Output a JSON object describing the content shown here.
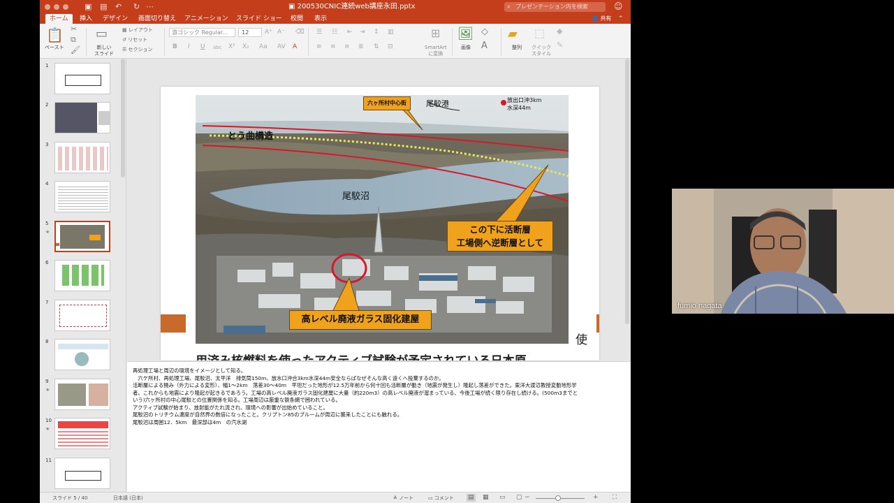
{
  "window": {
    "title": "200530CNIC連続web講座永田.pptx",
    "search_placeholder": "プレゼンテーション内を検索",
    "quick_access": [
      "save-icon",
      "undo-icon",
      "redo-icon"
    ]
  },
  "tabs": [
    {
      "label": "ホーム",
      "active": true
    },
    {
      "label": "挿入",
      "active": false
    },
    {
      "label": "デザイン",
      "active": false
    },
    {
      "label": "画面切り替え",
      "active": false
    },
    {
      "label": "アニメーション",
      "active": false
    },
    {
      "label": "スライド ショー",
      "active": false
    },
    {
      "label": "校閲",
      "active": false
    },
    {
      "label": "表示",
      "active": false
    }
  ],
  "share_label": "共有",
  "ribbon": {
    "paste": "ペースト",
    "new_slide": "新しい\nスライド",
    "layout": "レイアウト",
    "reset": "リセット",
    "section": "セクション",
    "font_name": "游ゴシック Regular...",
    "font_size": "12",
    "smartart": "SmartArt\nに変換",
    "picture": "画像",
    "arrange": "整列",
    "quick_styles": "クイック\nスタイル"
  },
  "thumbnails": [
    {
      "num": "1",
      "star": false,
      "kind": "title1"
    },
    {
      "num": "2",
      "star": false,
      "kind": "photo"
    },
    {
      "num": "3",
      "star": false,
      "kind": "doc"
    },
    {
      "num": "4",
      "star": false,
      "kind": "doc2"
    },
    {
      "num": "5",
      "star": true,
      "kind": "current"
    },
    {
      "num": "6",
      "star": false,
      "kind": "green"
    },
    {
      "num": "7",
      "star": false,
      "kind": "diagram"
    },
    {
      "num": "8",
      "star": false,
      "kind": "doc3"
    },
    {
      "num": "9",
      "star": true,
      "kind": "photo2"
    },
    {
      "num": "10",
      "star": true,
      "kind": "red"
    },
    {
      "num": "11",
      "star": false,
      "kind": "title2"
    }
  ],
  "slide": {
    "labels": {
      "rokkasho_center": "六ヶ所村中心街",
      "obuchi_port": "尾駮港",
      "outlet": "放出口沖3km",
      "depth": "水深44m",
      "flexure": "とう曲構造",
      "obuchi_marsh": "尾駮沼",
      "fault_line1": "この下に活断層",
      "fault_line2": "工場側へ逆断層として",
      "vitrification": "高レベル廃液ガラス固化建屋"
    },
    "side_char": "使",
    "cut_heading": "用済み核燃料を使ったアクティブ試験が予定されている日本原"
  },
  "notes": [
    "再処理工場と周辺の環境をイメージとして知る。",
    "　六ケ所村、再処理工場、尾駮沼、太平洋　排気筒150m、放水口沖合3km水深44m安全ならばなぜそんな高く遠くへ投棄するのか。",
    "活断層による撓み（外力による変形）、幅1〜2km　落差30〜40m　平坦だった地形が12.5万年前から何十回も活断層が動き（地震が発生し）隆起し落差ができた。東洋大渡辺教授変動地形学",
    "者。これからも地震により隆起が起きるであろう。工場の高レベル廃液ガラス固化建屋に大量（約220m3）の高レベル廃液が溜まっている、今後工場が続く限り存在し続ける。(500m3までと",
    "いう)六ヶ所村の中心尾駮との位置関係を知る。工場周辺は厳重な鉄条網で囲われている。",
    "アクティブ試験が始まり、放射能がたれ流され、環境への影響が出始めていること。",
    "尾駮沼のトリチウム濃度が自然界の数倍になったこと。クリプトン85のプルームが周辺に襲来したことにも触れる。",
    "尾駮沼は周囲12．5km　最深部は4m　の汽水湖"
  ],
  "status": {
    "slide_indicator": "スライド 5 / 40",
    "language": "日本語 (日本)",
    "notes_btn": "ノート",
    "comments_btn": "コメント"
  },
  "video": {
    "participant_name": "fumio nagata"
  }
}
